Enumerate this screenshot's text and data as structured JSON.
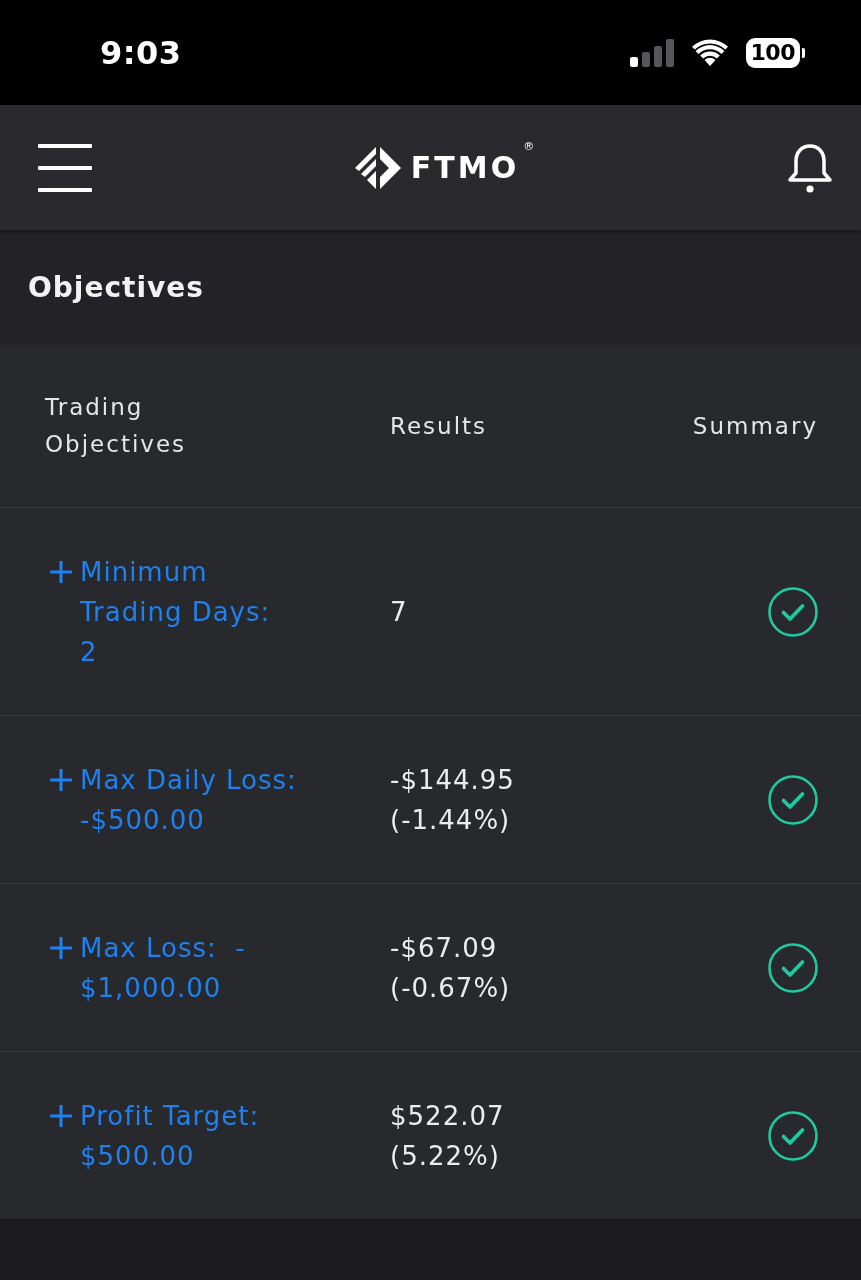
{
  "status_bar": {
    "time": "9:03",
    "battery": "100"
  },
  "header": {
    "logo": {
      "text": "FTMO",
      "mark": "®"
    }
  },
  "page": {
    "title": "Objectives"
  },
  "table": {
    "columns": [
      "Trading Objectives",
      "Results",
      "Summary"
    ],
    "rows": [
      {
        "objective": "Minimum\nTrading Days:\n2",
        "expanded": false,
        "result": "7",
        "passed": true
      },
      {
        "objective": "Max Daily Loss:\n-$500.00",
        "expanded": false,
        "result": "-$144.95 (-1.44%)",
        "passed": true
      },
      {
        "objective": "Max Loss:  -\n$1,000.00",
        "expanded": false,
        "result": "-$67.09 (-0.67%)",
        "passed": true
      },
      {
        "objective": "Profit Target:\n$500.00",
        "expanded": false,
        "result": "$522.07 (5.22%)",
        "passed": true
      }
    ]
  }
}
